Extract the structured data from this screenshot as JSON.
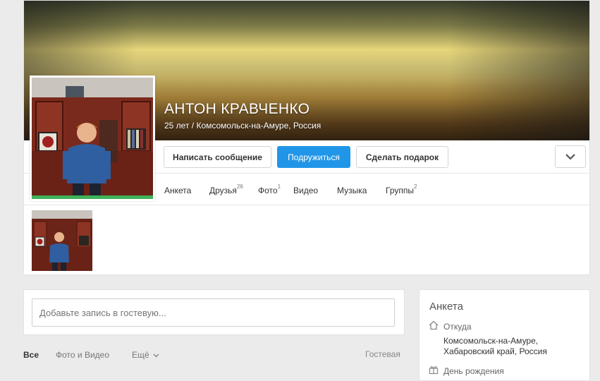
{
  "profile": {
    "name": "АНТОН КРАВЧЕНКО",
    "subtitle": "25 лет / Комсомольск-на-Амуре, Россия"
  },
  "actions": {
    "message": "Написать сообщение",
    "add_friend": "Подружиться",
    "gift": "Сделать подарок",
    "more_icon": "chevron-down-icon"
  },
  "nav": {
    "items": [
      {
        "label": "Анкета",
        "count": ""
      },
      {
        "label": "Друзья",
        "count": "26"
      },
      {
        "label": "Фото",
        "count": "1"
      },
      {
        "label": "Видео",
        "count": ""
      },
      {
        "label": "Музыка",
        "count": ""
      },
      {
        "label": "Группы",
        "count": "2"
      }
    ]
  },
  "post": {
    "placeholder": "Добавьте запись в гостевую..."
  },
  "feed": {
    "tabs": [
      "Все",
      "Фото и Видео",
      "Ещё"
    ],
    "guest_label": "Гостевая"
  },
  "info": {
    "title": "Анкета",
    "from_label": "Откуда",
    "from_value": "Комсомольск-на-Амуре, Хабаровский край, Россия",
    "birthday_label": "День рождения"
  },
  "colors": {
    "primary": "#2196e8",
    "online_bar": "#3fb25a"
  }
}
